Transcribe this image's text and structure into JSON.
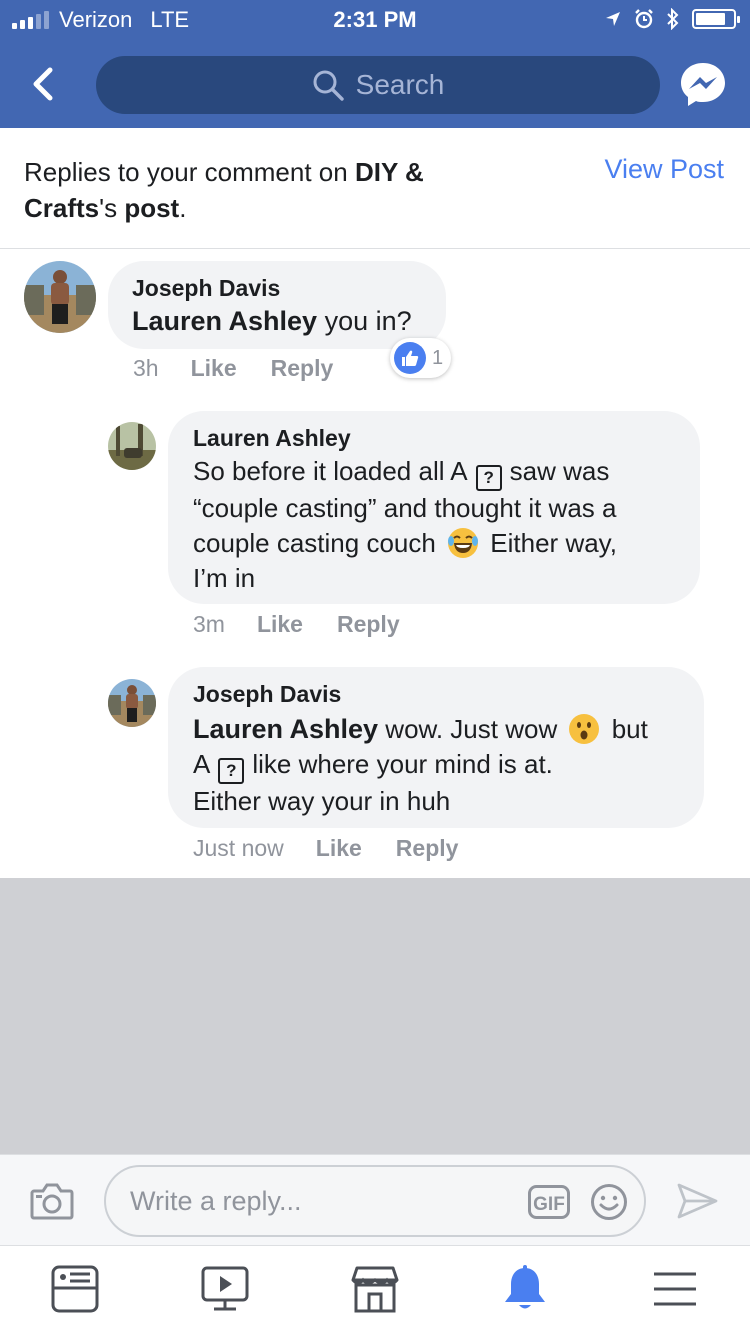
{
  "status_bar": {
    "carrier": "Verizon",
    "network": "LTE",
    "time": "2:31 PM",
    "battery_level": 0.8
  },
  "nav": {
    "search_placeholder": "Search"
  },
  "header": {
    "prefix": "Replies to your comment on ",
    "page_name": "DIY &",
    "page_name_2": "Crafts",
    "possessive": "'s ",
    "post_word": "post",
    "period": ".",
    "view_post": "View Post"
  },
  "comments": [
    {
      "author": "Joseph Davis",
      "mention": "Lauren Ashley",
      "text": " you in?",
      "time": "3h",
      "like": "Like",
      "reply": "Reply",
      "reaction_count": "1"
    },
    {
      "author": "Lauren Ashley",
      "line1a": "So before it loaded all A",
      "q": "?",
      "line1b": "saw was",
      "line2": "“couple casting” and thought it was a",
      "line3a": "couple casting couch",
      "line3b": "Either way,",
      "line4": "I’m in",
      "time": "3m",
      "like": "Like",
      "reply": "Reply"
    },
    {
      "author": "Joseph Davis",
      "mention": "Lauren Ashley",
      "line1a": " wow. Just wow",
      "line1b": "but",
      "line2a": "A",
      "q": "?",
      "line2b": "like where your mind is at.",
      "line3": "Either way your in huh",
      "time": "Just now",
      "like": "Like",
      "reply": "Reply"
    }
  ],
  "composer": {
    "placeholder": "Write a reply...",
    "gif_label": "GIF"
  },
  "icons": {
    "back": "chevron-left-icon",
    "search": "search-icon",
    "messenger": "messenger-icon",
    "camera": "camera-icon",
    "smiley": "emoji-icon",
    "send": "send-icon",
    "tabs": [
      "news-feed-icon",
      "watch-icon",
      "marketplace-icon",
      "notifications-icon",
      "menu-icon"
    ]
  },
  "colors": {
    "brand": "#4267b2",
    "link": "#4a7ff0",
    "active_tab": "#4a7ff0"
  }
}
